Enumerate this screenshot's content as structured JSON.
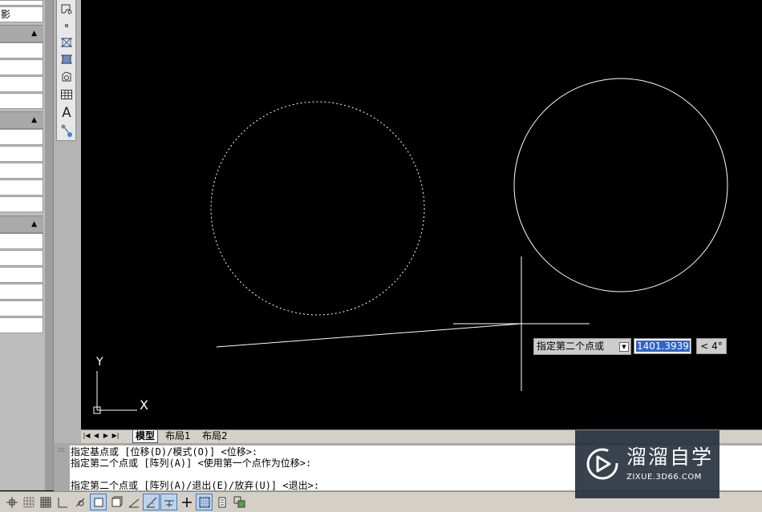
{
  "properties_palette": {
    "top_cell_1": "",
    "top_cell_2": "影",
    "sections": [
      {
        "name": "section-1",
        "rows": [
          "",
          "",
          "",
          "",
          ""
        ]
      },
      {
        "name": "section-2",
        "rows": [
          "",
          "",
          "",
          "",
          ""
        ]
      },
      {
        "name": "section-3",
        "rows": [
          "",
          "",
          "",
          "",
          "",
          "",
          ""
        ]
      }
    ]
  },
  "draw_toolbar": {
    "text_tool_glyph": "A"
  },
  "canvas": {
    "background": "#000000",
    "ucs_x_label": "X",
    "ucs_y_label": "Y"
  },
  "layout_tabs": {
    "tabs": [
      "模型",
      "布局1",
      "布局2"
    ],
    "active": "模型"
  },
  "dynamic_input": {
    "prompt": "指定第二个点或",
    "distance_value": "1401.3939",
    "angle": "< 4°"
  },
  "command_line": {
    "history": [
      "指定基点或 [位移(D)/模式(O)] <位移>:",
      "指定第二个点或 [阵列(A)] <使用第一个点作为位移>:"
    ],
    "current": "指定第二个点或 [阵列(A)/退出(E)/放弃(U)] <退出>:"
  },
  "status_bar": {
    "buttons": [
      "snap-icon",
      "grid-icon",
      "ortho-icon",
      "polar-icon",
      "osnap-icon",
      "otrack-icon",
      "ducs-icon",
      "dyn-icon",
      "lineweight-icon",
      "qp-icon",
      "sc-icon",
      "model-icon"
    ]
  },
  "watermark": {
    "title": "溜溜自学",
    "subtitle": "ZIXUE.3D66.COM"
  },
  "colors": {
    "canvas": "#000000",
    "drawing": "#ffffff",
    "selection": "#2f64c8",
    "panel": "#bdbdbd"
  }
}
